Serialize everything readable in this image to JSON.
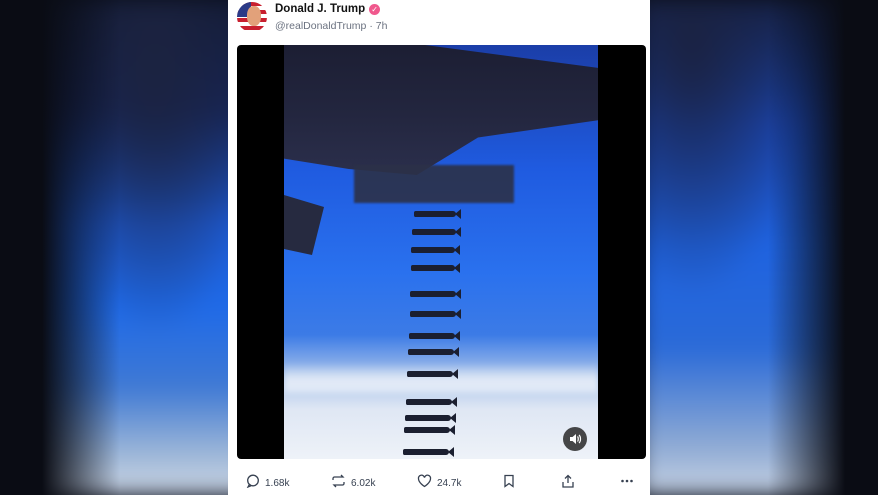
{
  "post": {
    "author_name": "Donald J. Trump",
    "handle": "@realDonaldTrump",
    "separator": "·",
    "time_ago": "7h",
    "verified_icon": "verified-badge-icon",
    "avatar_icon": "flag-portrait-avatar"
  },
  "media": {
    "type": "video",
    "sound_icon": "speaker-icon"
  },
  "actions": {
    "replies": "1.68k",
    "retruths": "6.02k",
    "likes": "24.7k",
    "icons": [
      "reply-icon",
      "retruth-icon",
      "heart-icon",
      "bookmark-icon",
      "share-icon",
      "more-icon"
    ]
  },
  "colors": {
    "verified": "#f0588d",
    "sky": "#2a71ee",
    "card": "#ffffff"
  }
}
